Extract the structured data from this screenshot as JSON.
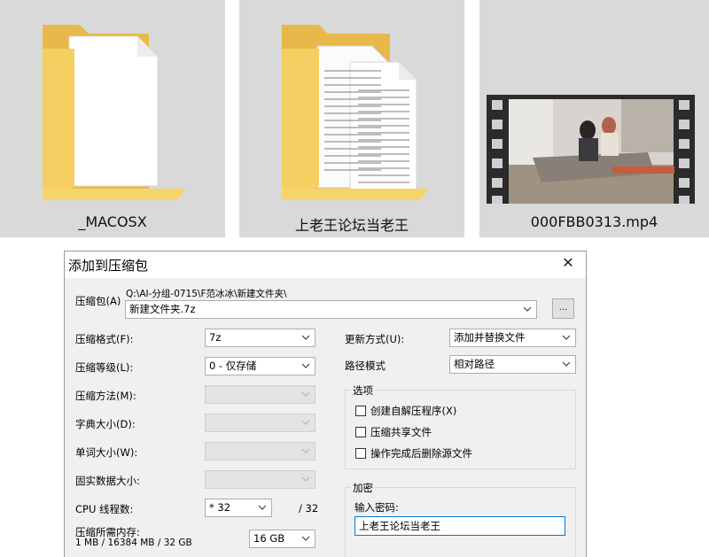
{
  "explorer": {
    "items": [
      {
        "name": "_MACOSX",
        "icon": "folder-icon"
      },
      {
        "name": "上老王论坛当老王",
        "icon": "folder-with-documents-icon"
      },
      {
        "name": "000FBB0313.mp4",
        "icon": "video-thumbnail-icon"
      }
    ]
  },
  "dialog": {
    "title": "添加到压缩包",
    "close_glyph": "✕",
    "archive": {
      "label": "压缩包(A)",
      "path": "Q:\\AI-分组-0715\\F范冰冰\\新建文件夹\\",
      "filename": "新建文件夹.7z",
      "browse_label": "..."
    },
    "left": {
      "format_label": "压缩格式(F):",
      "format_value": "7z",
      "level_label": "压缩等级(L):",
      "level_value": "0 - 仅存储",
      "method_label": "压缩方法(M):",
      "dict_label": "字典大小(D):",
      "word_label": "单词大小(W):",
      "solid_label": "固实数据大小:",
      "cpu_label": "CPU 线程数:",
      "cpu_value": "* 32",
      "cpu_total": "/ 32",
      "memory_label": "压缩所需内存:",
      "memory_detail": "1 MB / 16384 MB / 32 GB",
      "memory_value": "16 GB"
    },
    "right": {
      "update_label": "更新方式(U):",
      "update_value": "添加并替换文件",
      "path_label": "路径模式",
      "path_value": "相对路径",
      "options_title": "选项",
      "option_sfx": "创建自解压程序(X)",
      "option_shared": "压缩共享文件",
      "option_delete": "操作完成后删除源文件",
      "encrypt_title": "加密",
      "password_label": "输入密码:",
      "password_value": "上老王论坛当老王"
    }
  },
  "colors": {
    "tile_bg": "#d9d9d9",
    "folder_yellow": "#f5cf62",
    "dialog_bg": "#f0f0f0",
    "focus_border": "#0078d7"
  }
}
